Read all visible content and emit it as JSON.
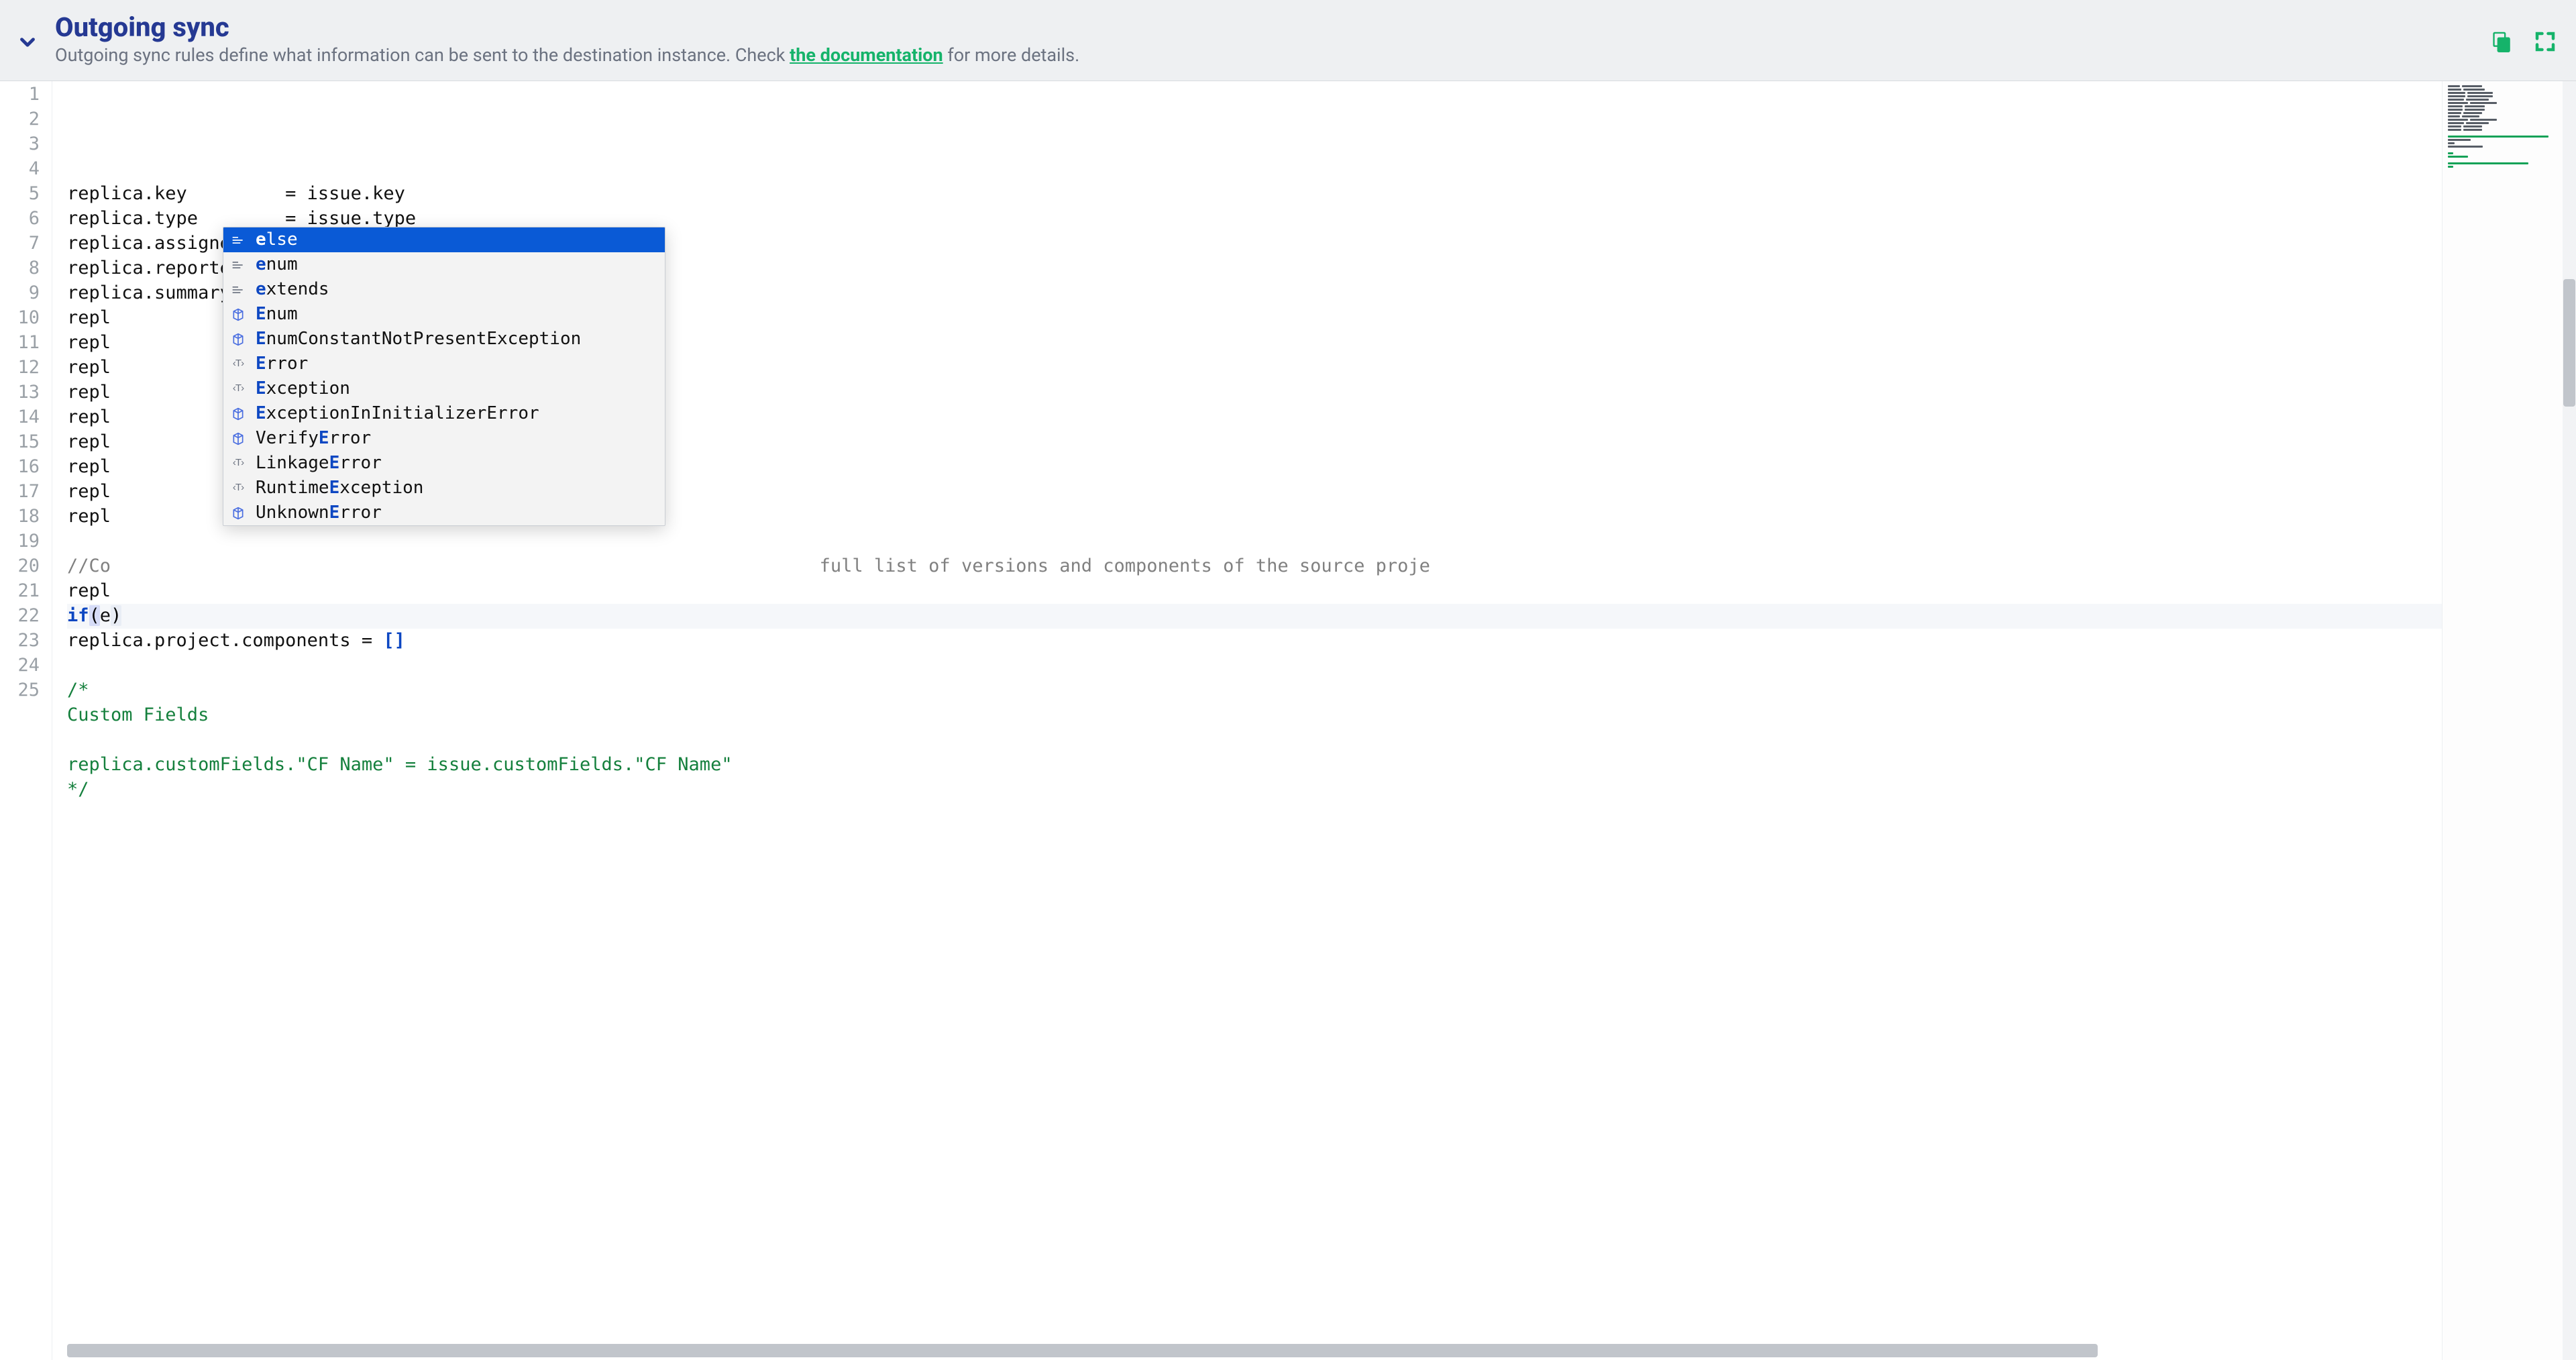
{
  "header": {
    "title": "Outgoing sync",
    "subtitle_pre": "Outgoing sync rules define what information can be sent to the destination instance. Check ",
    "doc_link_label": "the documentation",
    "subtitle_post": " for more details."
  },
  "code": {
    "lines": [
      [
        {
          "t": "replica.key         = issue.key",
          "c": "id"
        }
      ],
      [
        {
          "t": "replica.type        = issue.type",
          "c": "id"
        }
      ],
      [
        {
          "t": "replica.assignee    = issue.assignee",
          "c": "id"
        }
      ],
      [
        {
          "t": "replica.reporter    = issue.reporter",
          "c": "id"
        }
      ],
      [
        {
          "t": "replica.summary     = issue.summary",
          "c": "id"
        }
      ],
      [
        {
          "t": "repl",
          "c": "id"
        }
      ],
      [
        {
          "t": "repl",
          "c": "id"
        }
      ],
      [
        {
          "t": "repl",
          "c": "id"
        }
      ],
      [
        {
          "t": "repl",
          "c": "id"
        }
      ],
      [
        {
          "t": "repl",
          "c": "id"
        }
      ],
      [
        {
          "t": "repl",
          "c": "id"
        }
      ],
      [
        {
          "t": "repl",
          "c": "id"
        }
      ],
      [
        {
          "t": "repl",
          "c": "id"
        }
      ],
      [
        {
          "t": "repl",
          "c": "id"
        }
      ],
      [
        {
          "t": "",
          "c": "id"
        }
      ],
      [
        {
          "t": "//Co                                                                 full list of versions and components of the source proje",
          "c": "comment"
        }
      ],
      [
        {
          "t": "repl",
          "c": "id"
        }
      ],
      [
        {
          "t": "if",
          "c": "kw"
        },
        {
          "t": "(",
          "c": "ap"
        },
        {
          "t": "e",
          "c": "id"
        },
        {
          "t": ")",
          "c": "cp"
        }
      ],
      [
        {
          "t": "replica.project.components = ",
          "c": "id"
        },
        {
          "t": "[]",
          "c": "br"
        }
      ],
      [
        {
          "t": "",
          "c": "id"
        }
      ],
      [
        {
          "t": "/*",
          "c": "green"
        }
      ],
      [
        {
          "t": "Custom Fields",
          "c": "green"
        }
      ],
      [
        {
          "t": "",
          "c": "id"
        }
      ],
      [
        {
          "t": "replica.customFields.\"CF Name\" = issue.customFields.\"CF Name\"",
          "c": "green"
        }
      ],
      [
        {
          "t": "*/",
          "c": "green"
        }
      ]
    ],
    "current_line_index": 17
  },
  "autocomplete": {
    "selected_index": 0,
    "items": [
      {
        "kind": "snippet",
        "text": "else",
        "match": [
          0
        ]
      },
      {
        "kind": "snippet",
        "text": "enum",
        "match": [
          0
        ]
      },
      {
        "kind": "snippet",
        "text": "extends",
        "match": [
          0
        ]
      },
      {
        "kind": "class",
        "text": "Enum",
        "match": [
          0
        ]
      },
      {
        "kind": "class",
        "text": "EnumConstantNotPresentException",
        "match": [
          0
        ]
      },
      {
        "kind": "type",
        "text": "Error",
        "match": [
          0
        ]
      },
      {
        "kind": "type",
        "text": "Exception",
        "match": [
          0
        ]
      },
      {
        "kind": "class",
        "text": "ExceptionInInitializerError",
        "match": [
          0
        ]
      },
      {
        "kind": "class",
        "text": "VerifyError",
        "match": [
          6
        ]
      },
      {
        "kind": "type",
        "text": "LinkageError",
        "match": [
          7
        ]
      },
      {
        "kind": "type",
        "text": "RuntimeException",
        "match": [
          7
        ]
      },
      {
        "kind": "class",
        "text": "UnknownError",
        "match": [
          7
        ]
      }
    ]
  },
  "colors": {
    "accent_green": "#15b36a",
    "title_blue": "#253993",
    "kw_blue": "#0d47c2",
    "selection_blue": "#0a5ad6"
  }
}
